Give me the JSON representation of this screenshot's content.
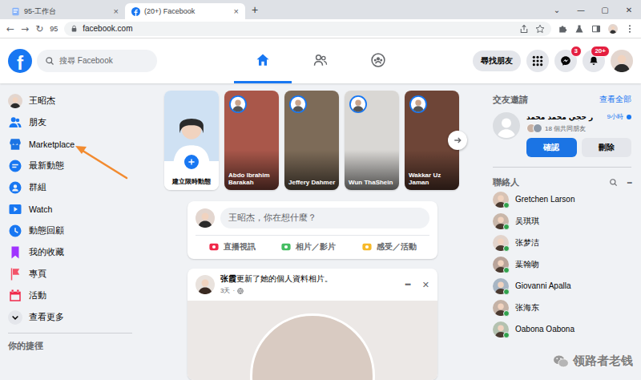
{
  "browser": {
    "tabs": [
      {
        "label": "95-工作台",
        "selected": false
      },
      {
        "label": "(20+) Facebook",
        "selected": true
      }
    ],
    "tab_close": "×",
    "new_tab": "+",
    "window_controls": [
      "⌄",
      "—",
      "▢",
      "✕"
    ],
    "nav_buttons": [
      "←",
      "→",
      "↻"
    ],
    "profile_label": "95",
    "url": "facebook.com"
  },
  "header": {
    "logo": "f",
    "search_placeholder": "搜尋 Facebook",
    "nav": [
      {
        "kind": "home",
        "selected": true
      },
      {
        "kind": "friends",
        "selected": false
      },
      {
        "kind": "groups",
        "selected": false
      }
    ],
    "find_friends": "尋找朋友",
    "messenger_badge": "3",
    "notifications_badge": "20+"
  },
  "sidebar": {
    "items": [
      {
        "label": "王昭杰",
        "kind": "avatar"
      },
      {
        "label": "朋友",
        "kind": "icon"
      },
      {
        "label": "Marketplace",
        "kind": "icon"
      },
      {
        "label": "最新動態",
        "kind": "icon"
      },
      {
        "label": "群組",
        "kind": "icon"
      },
      {
        "label": "Watch",
        "kind": "icon"
      },
      {
        "label": "動態回顧",
        "kind": "icon"
      },
      {
        "label": "我的收藏",
        "kind": "icon"
      },
      {
        "label": "專頁",
        "kind": "icon"
      },
      {
        "label": "活動",
        "kind": "icon"
      },
      {
        "label": "查看更多",
        "kind": "more"
      }
    ],
    "section_title": "你的捷徑"
  },
  "stories": {
    "items": [
      {
        "label": "建立限時動態",
        "kind": "create"
      },
      {
        "label": "Abdo Ibrahim Barakah",
        "kind": "story"
      },
      {
        "label": "Jeffery Dahmer",
        "kind": "story"
      },
      {
        "label": "Wun ThaShein",
        "kind": "story"
      },
      {
        "label": "Wakkar Uz Jaman",
        "kind": "story"
      }
    ]
  },
  "composer": {
    "placeholder": "王昭杰，你在想什麼？",
    "actions": [
      {
        "label": "直播視訊",
        "color": "#f02849"
      },
      {
        "label": "相片／影片",
        "color": "#45bd62"
      },
      {
        "label": "感受／活動",
        "color": "#f7b928"
      }
    ]
  },
  "post": {
    "author": "张霞",
    "action": "更新了她的個人資料相片。",
    "time": "3天",
    "separator": "·",
    "menu": "•••",
    "close": "✕"
  },
  "friend_requests": {
    "title": "交友邀請",
    "see_all": "查看全部",
    "items": [
      {
        "name": "ر حجي محمد محمد",
        "time": "9小時",
        "unread": true,
        "mutual": "18 個共同朋友",
        "confirm": "確認",
        "delete": "刪除"
      }
    ]
  },
  "contacts": {
    "title": "聯絡人",
    "menu": "•••",
    "items": [
      {
        "name": "Gretchen Larson",
        "online": true
      },
      {
        "name": "吴琪琪",
        "online": true
      },
      {
        "name": "张梦洁",
        "online": true
      },
      {
        "name": "葉翰吻",
        "online": true
      },
      {
        "name": "Giovanni Apalla",
        "online": true
      },
      {
        "name": "张海东",
        "online": true
      },
      {
        "name": "Oabona Oabona",
        "online": true
      }
    ]
  },
  "watermark": "领路者老钱"
}
